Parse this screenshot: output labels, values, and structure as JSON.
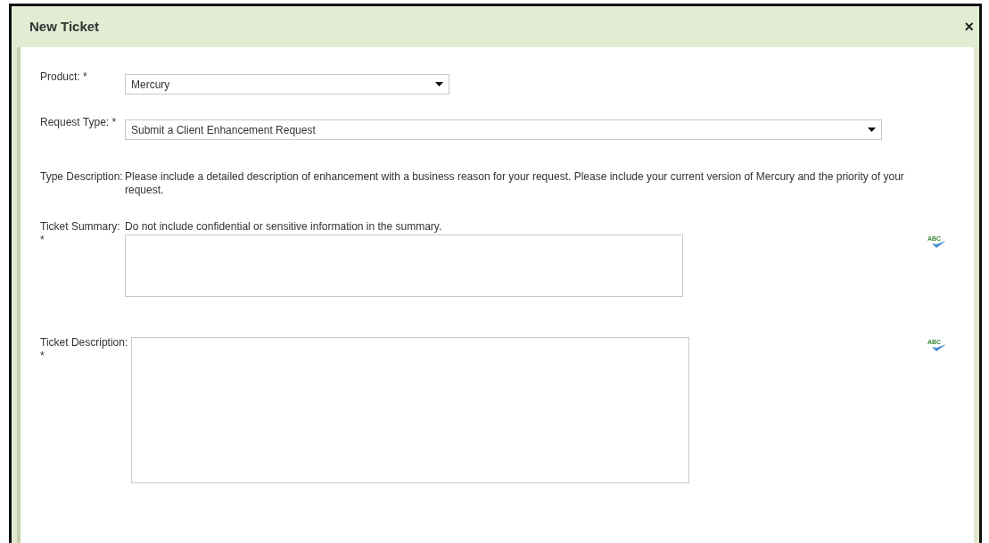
{
  "window": {
    "title": "New Ticket",
    "close": "×"
  },
  "fields": [
    {
      "kind": "select",
      "label": "Product: *",
      "value": "Mercury"
    },
    {
      "kind": "select",
      "label": "Request Type: *",
      "value": "Submit a Client Enhancement Request"
    },
    {
      "kind": "info",
      "label": "Type Description:",
      "text": "Please include a detailed description of enhancement with a business reason for your request.  Please include your current version of Mercury and the priority of your request."
    },
    {
      "kind": "textarea",
      "label": "Ticket Summary: *",
      "hint": "Do not include confidential or sensitive information in the summary.",
      "spellcheck": "ABC"
    },
    {
      "kind": "textarea",
      "label": "Ticket Description: *",
      "spellcheck": "ABC"
    }
  ]
}
